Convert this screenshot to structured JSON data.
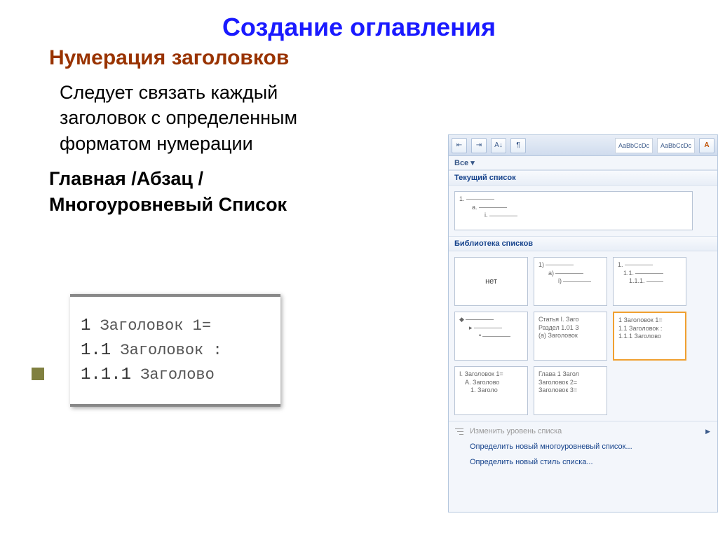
{
  "slide": {
    "title": "Создание оглавления",
    "section": "Нумерация заголовков",
    "body": "Следует связать каждый заголовок с определенным форматом нумерации",
    "path": "Главная /Абзац / Многоуровневый Список"
  },
  "example": {
    "l1_num": "1",
    "l1_txt": "Заголовок 1=",
    "l2_num": "1.1",
    "l2_txt": "Заголовок :",
    "l3_num": "1.1.1",
    "l3_txt": "Заголово"
  },
  "panel": {
    "toolbar": {
      "style1": "AaBbCcDc",
      "style2": "AaBbCcDc",
      "sort": "A↓"
    },
    "all_label": "Все ▾",
    "current_list_header": "Текущий список",
    "current_tile": {
      "l1": "1.",
      "l2": "a.",
      "l3": "i."
    },
    "library_header": "Библиотека списков",
    "library": [
      {
        "mode": "none",
        "label": "нет"
      },
      {
        "l1": "1)",
        "l2": "a)",
        "l3": "i)"
      },
      {
        "l1": "1.",
        "l2": "1.1.",
        "l3": "1.1.1."
      },
      {
        "l1": "◆",
        "l2": "▸",
        "l3": "•"
      },
      {
        "l1": "Статья I. Заго",
        "l2": "Раздел 1.01 З",
        "l3": "(a) Заголовок"
      },
      {
        "l1": "1 Заголовок 1=",
        "l2": "1.1 Заголовок :",
        "l3": "1.1.1 Заголово"
      },
      {
        "l1": "I. Заголовок 1=",
        "l2": "A. Заголово",
        "l3": "1. Заголо"
      },
      {
        "l1": "Глава 1 Загол",
        "l2": "Заголовок 2=",
        "l3": "Заголовок 3="
      }
    ],
    "menu": {
      "change_level": "Изменить уровень списка",
      "define_multilevel": "Определить новый многоуровневый список...",
      "define_style": "Определить новый стиль списка..."
    }
  }
}
